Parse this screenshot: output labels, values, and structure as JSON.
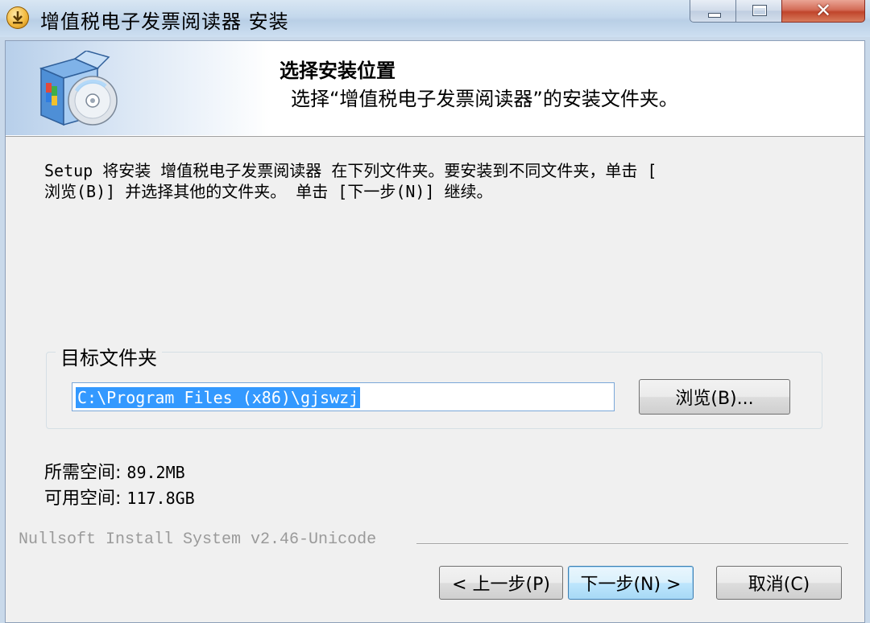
{
  "window": {
    "title": "增值税电子发票阅读器 安装",
    "close_glyph": "✕"
  },
  "header": {
    "title": "选择安装位置",
    "subtitle": "选择“增值税电子发票阅读器”的安装文件夹。"
  },
  "intro_text": "Setup 将安装 增值税电子发票阅读器 在下列文件夹。要安装到不同文件夹，单击 [\n浏览(B)] 并选择其他的文件夹。 单击 [下一步(N)] 继续。",
  "destination": {
    "group_label": "目标文件夹",
    "path": "C:\\Program Files (x86)\\gjswzj",
    "browse_label": "浏览(B)..."
  },
  "space": {
    "required_label": "所需空间:",
    "required_value": "89.2MB",
    "available_label": "可用空间:",
    "available_value": "117.8GB"
  },
  "footer": {
    "brand": "Nullsoft Install System v2.46-Unicode",
    "back_label": "< 上一步(P)",
    "next_label": "下一步(N) >",
    "cancel_label": "取消(C)"
  },
  "colors": {
    "selection": "#3399ff",
    "background": "#f0f0f0"
  }
}
